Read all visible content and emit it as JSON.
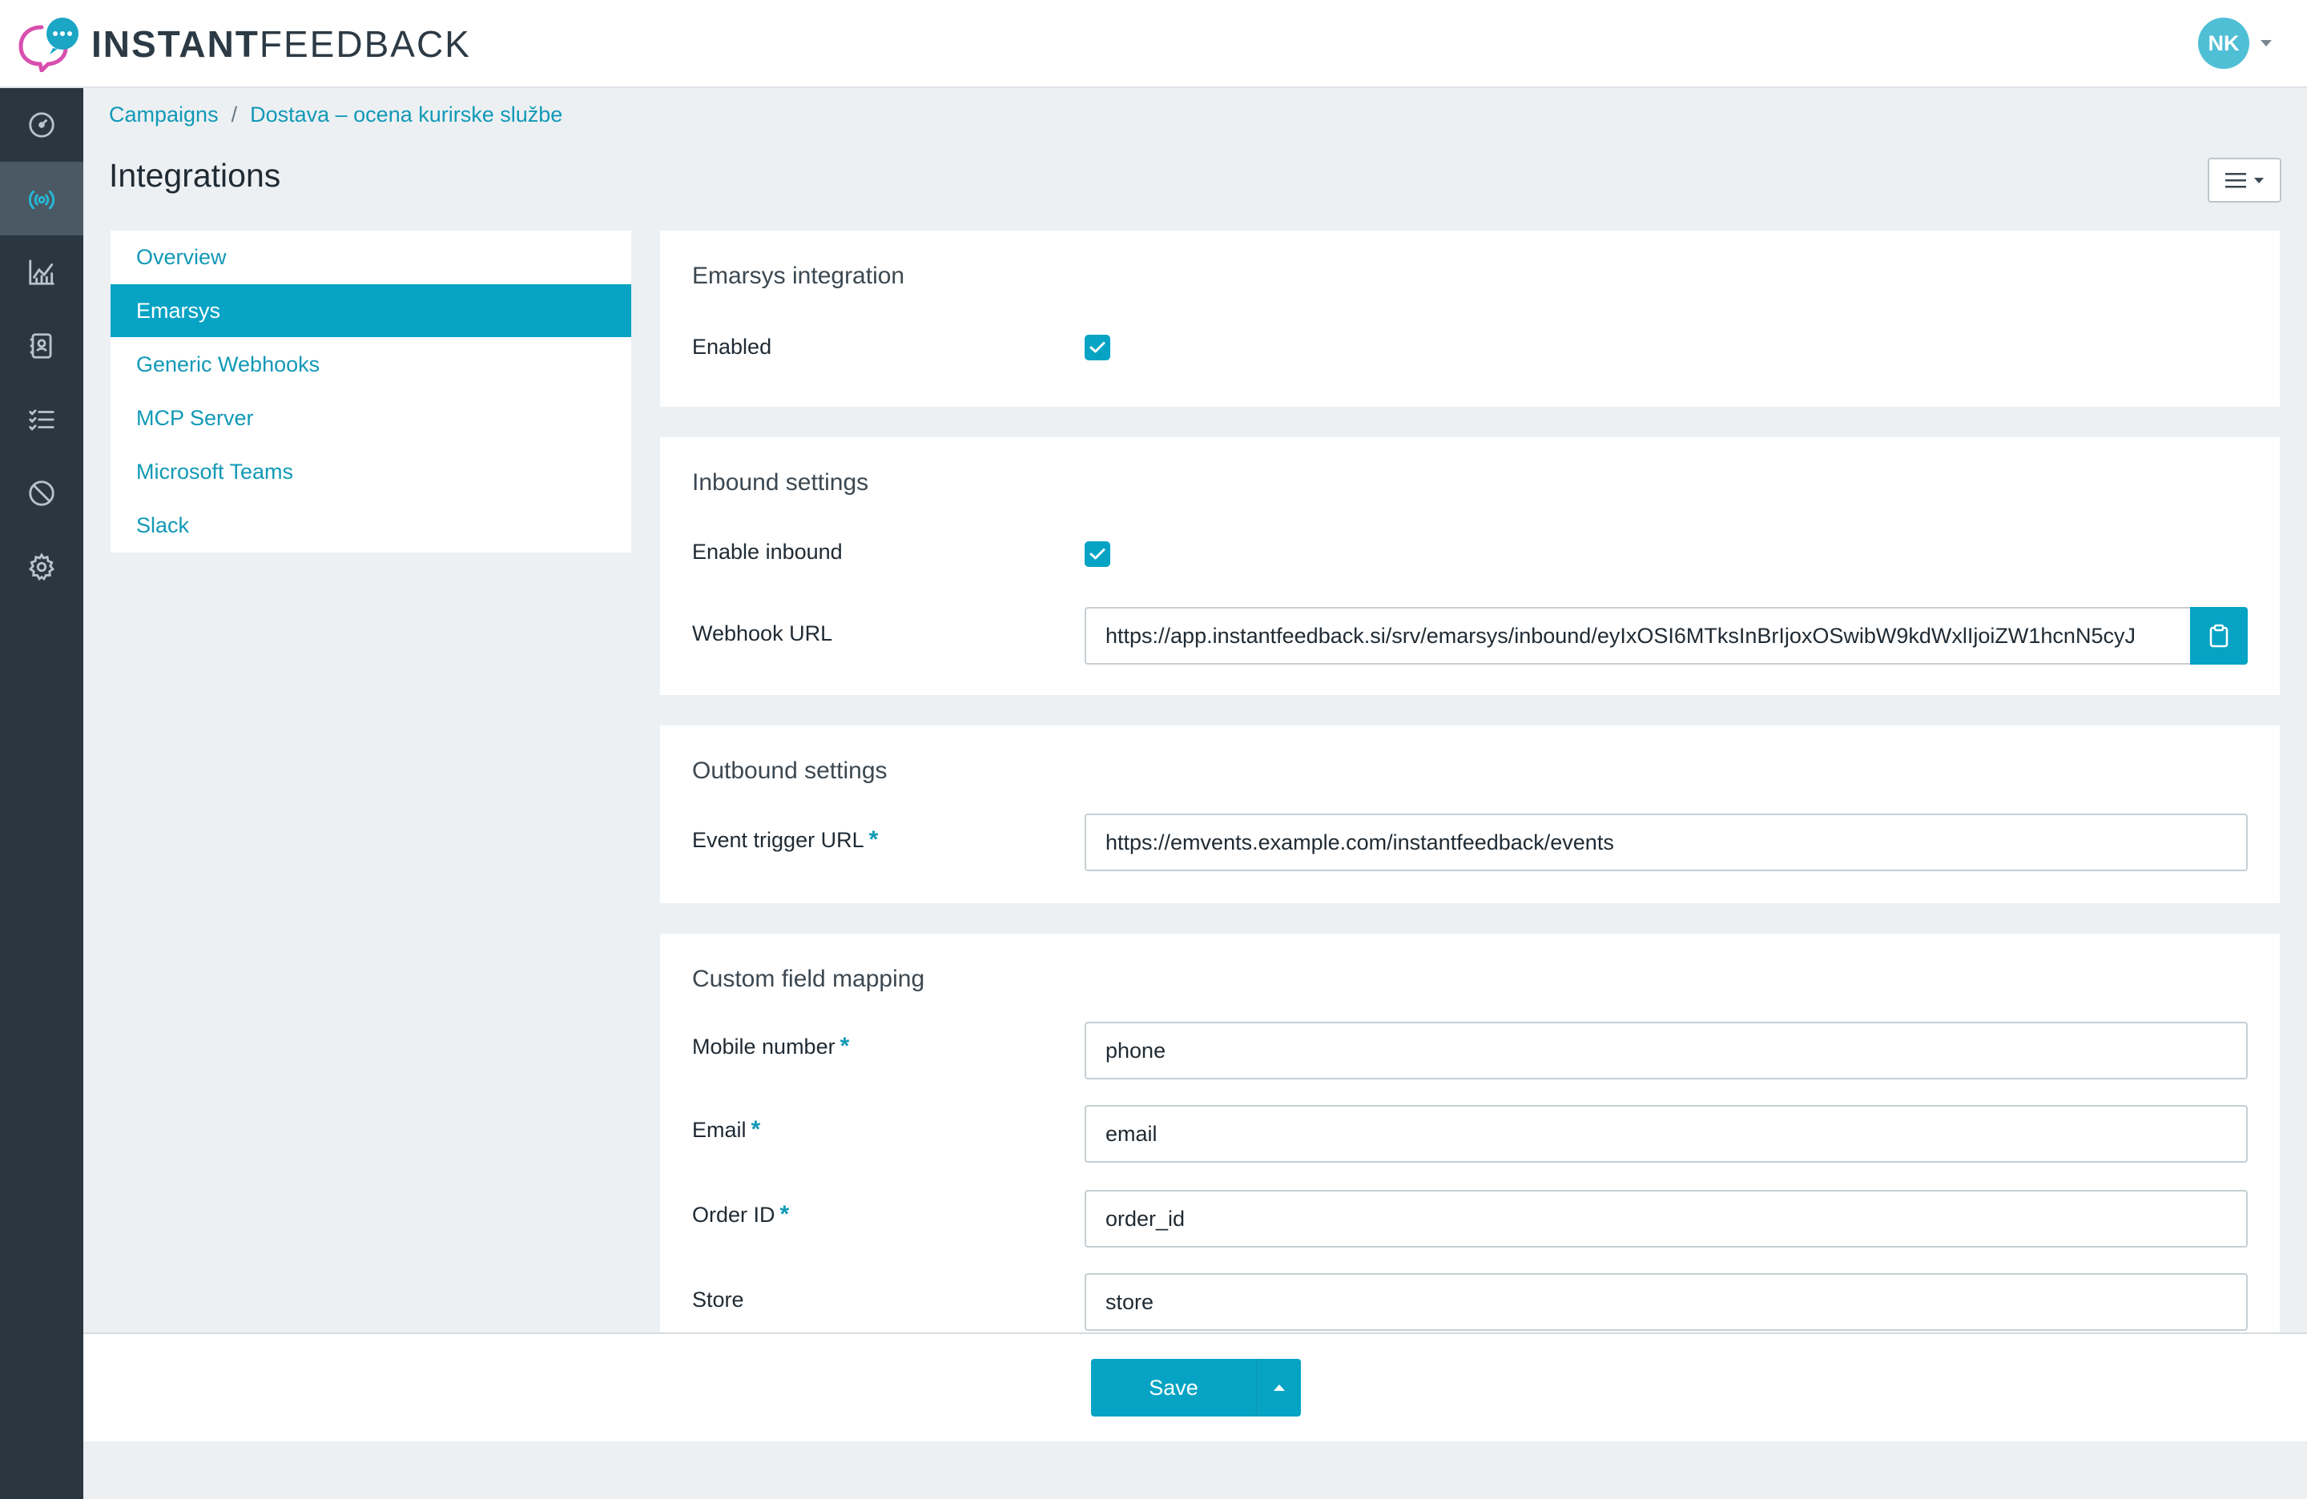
{
  "brand": {
    "bold": "INSTANT",
    "light": "FEEDBACK"
  },
  "user": {
    "initials": "NK"
  },
  "sidebar": {
    "items": [
      {
        "icon": "dashboard-icon"
      },
      {
        "icon": "broadcast-icon",
        "active": true
      },
      {
        "icon": "analytics-icon"
      },
      {
        "icon": "contacts-icon"
      },
      {
        "icon": "checklist-icon"
      },
      {
        "icon": "block-icon"
      },
      {
        "icon": "gear-icon"
      }
    ]
  },
  "breadcrumb": {
    "root": "Campaigns",
    "separator": "/",
    "current": "Dostava – ocena kurirske službe"
  },
  "page": {
    "title": "Integrations"
  },
  "nav": {
    "items": [
      {
        "label": "Overview"
      },
      {
        "label": "Emarsys"
      },
      {
        "label": "Generic Webhooks"
      },
      {
        "label": "MCP Server"
      },
      {
        "label": "Microsoft Teams"
      },
      {
        "label": "Slack"
      }
    ],
    "active_index": 1
  },
  "emarsys": {
    "title": "Emarsys integration",
    "enabled_label": "Enabled",
    "enabled": true
  },
  "inbound": {
    "title": "Inbound settings",
    "enable_label": "Enable inbound",
    "enabled": true,
    "webhook_label": "Webhook URL",
    "webhook_value": "https://app.instantfeedback.si/srv/emarsys/inbound/eyIxOSI6MTksInBrIjoxOSwibW9kdWxlIjoiZW1hcnN5cyJ"
  },
  "outbound": {
    "title": "Outbound settings",
    "trigger_label": "Event trigger URL",
    "required_mark": "*",
    "trigger_value": "https://emvents.example.com/instantfeedback/events"
  },
  "mapping": {
    "title": "Custom field mapping",
    "required_mark": "*",
    "fields": [
      {
        "label": "Mobile number",
        "value": "phone",
        "required": true
      },
      {
        "label": "Email",
        "value": "email",
        "required": true
      },
      {
        "label": "Order ID",
        "value": "order_id",
        "required": true
      },
      {
        "label": "Store",
        "value": "store",
        "required": false
      }
    ]
  },
  "footer": {
    "save_label": "Save"
  },
  "colors": {
    "accent": "#06a3c4",
    "sidebar": "#2b3740",
    "background": "#ecf0f3"
  }
}
